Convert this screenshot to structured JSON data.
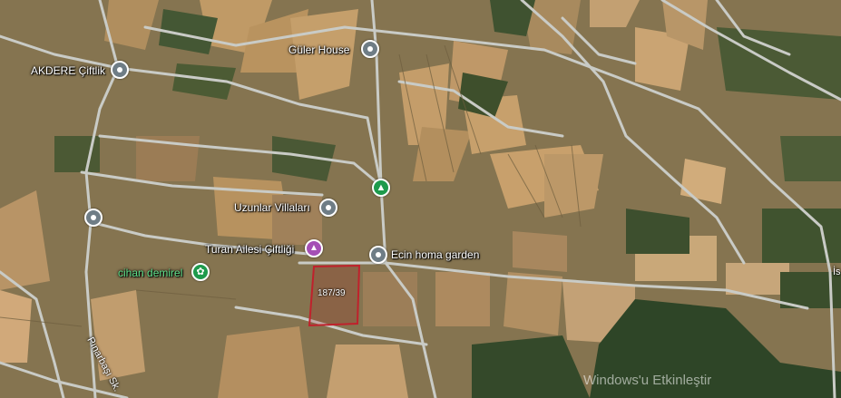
{
  "map": {
    "places": [
      {
        "id": "guler-house",
        "name": "Güler House",
        "type": "place"
      },
      {
        "id": "akdere",
        "name": "AKDERE Çiftlik",
        "type": "place"
      },
      {
        "id": "park",
        "name": "",
        "type": "park"
      },
      {
        "id": "uzunlar",
        "name": "Uzunlar Villaları",
        "type": "place"
      },
      {
        "id": "unnamed-west",
        "name": "",
        "type": "place"
      },
      {
        "id": "turan",
        "name": "Turan Ailesi Çiftliği",
        "type": "event-venue"
      },
      {
        "id": "ecin",
        "name": "Ecin homa garden",
        "type": "place"
      },
      {
        "id": "cihan",
        "name": "cihan demirel",
        "type": "business"
      }
    ],
    "parcel": {
      "label": "187/39",
      "outline_color": "#c0212c"
    },
    "roads": {
      "pinarbasi": "Pınarbaşı Sk.",
      "edge": "İs"
    },
    "watermark": "Windows'u Etkinleştir"
  },
  "colors": {
    "place_pin": "#6f7d86",
    "park_pin": "#1e9a4c",
    "event_pin": "#a54fb5",
    "business_label": "#5ee08a",
    "road": "#c9cbc6"
  }
}
